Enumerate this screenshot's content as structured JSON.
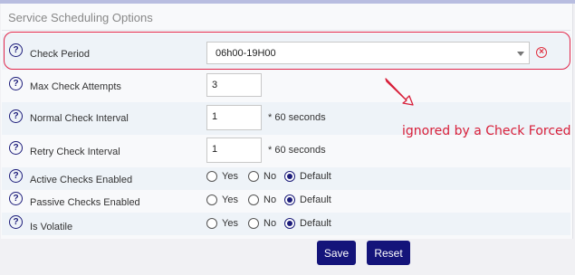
{
  "section": {
    "title": "Service Scheduling Options"
  },
  "check_period": {
    "label": "Check Period",
    "value": "06h00-19H00"
  },
  "max_check_attempts": {
    "label": "Max Check Attempts",
    "value": "3"
  },
  "normal_check_interval": {
    "label": "Normal Check Interval",
    "value": "1",
    "unit": "* 60 seconds"
  },
  "retry_check_interval": {
    "label": "Retry Check Interval",
    "value": "1",
    "unit": "* 60 seconds"
  },
  "active_checks": {
    "label": "Active Checks Enabled",
    "options": [
      "Yes",
      "No",
      "Default"
    ],
    "selected": "Default"
  },
  "passive_checks": {
    "label": "Passive Checks Enabled",
    "options": [
      "Yes",
      "No",
      "Default"
    ],
    "selected": "Default"
  },
  "is_volatile": {
    "label": "Is Volatile",
    "options": [
      "Yes",
      "No",
      "Default"
    ],
    "selected": "Default"
  },
  "buttons": {
    "save": "Save",
    "reset": "Reset"
  },
  "annotation": {
    "text": "ignored by a Check Forced",
    "color": "#d8203a"
  },
  "colors": {
    "button": "#14147a",
    "help_icon": "#1c1c7a",
    "alt_row": "#eef3f8"
  }
}
